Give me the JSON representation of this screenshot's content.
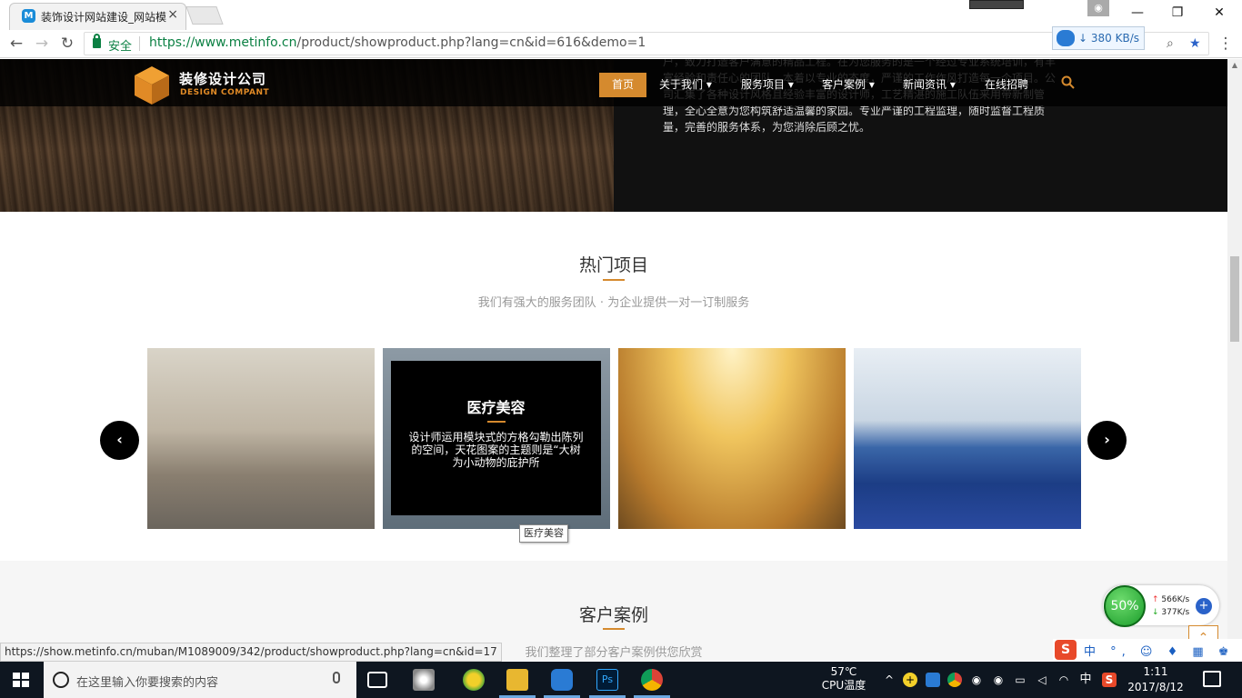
{
  "browser": {
    "tab_title": "装饰设计网站建设_网站模",
    "tab_close": "×",
    "favicon_letter": "M",
    "secure_label": "安全",
    "url_host": "https://www.metinfo.cn",
    "url_path": "/product/showproduct.php?lang=cn&id=616&demo=1",
    "net_speed": "380 KB/s",
    "status_url": "https://show.metinfo.cn/muban/M1089009/342/product/showproduct.php?lang=cn&id=17",
    "window_controls": {
      "minimize": "—",
      "restore": "❐",
      "close": "✕"
    }
  },
  "site": {
    "logo_cn": "装修设计公司",
    "logo_en": "DESIGN COMPANT",
    "nav": {
      "home": "首页",
      "items": [
        "关于我们",
        "服务项目",
        "客户案例",
        "新闻资讯",
        "在线招聘"
      ]
    },
    "hero_text": "户，致力打造客户满意的精品工程。在为您服务的是一个经过专业系统培训，有丰富经验和责任心的团队，本着以专业的态度，严谨的工作作风打造每一个项目。公司汇集了各种设计风格且经验丰富的设计师，工艺精湛的施工队伍来用带新制管理，全心全意为您构筑舒适温馨的家园。专业严谨的工程监理，随时监督工程质量，完善的服务体系，为您消除后顾之忧。",
    "hot": {
      "title": "热门项目",
      "subtitle": "我们有强大的服务团队 · 为企业提供一对一订制服务",
      "overlay_title": "医疗美容",
      "overlay_desc": "设计师运用模块式的方格勾勒出陈列的空间，天花图案的主题则是“大树为小动物的庇护所",
      "tooltip": "医疗美容",
      "prev": "‹",
      "next": "›"
    },
    "cases": {
      "title": "客户案例",
      "subtitle": "我们整理了部分客户案例供您欣赏"
    }
  },
  "overlays": {
    "net_percent": "50%",
    "upload": "566K/s",
    "download": "377K/s",
    "ime_chars": "中 °, ☺ ♦ ▦ ♚ ♛ ✱"
  },
  "taskbar": {
    "search_placeholder": "在这里输入你要搜索的内容",
    "cpu_temp": "57℃",
    "cpu_label": "CPU温度",
    "lang": "中",
    "time": "1:11",
    "date": "2017/8/12"
  },
  "colors": {
    "accent": "#d58a2e",
    "secure": "#0b8043",
    "taskbar": "#0e1620"
  }
}
